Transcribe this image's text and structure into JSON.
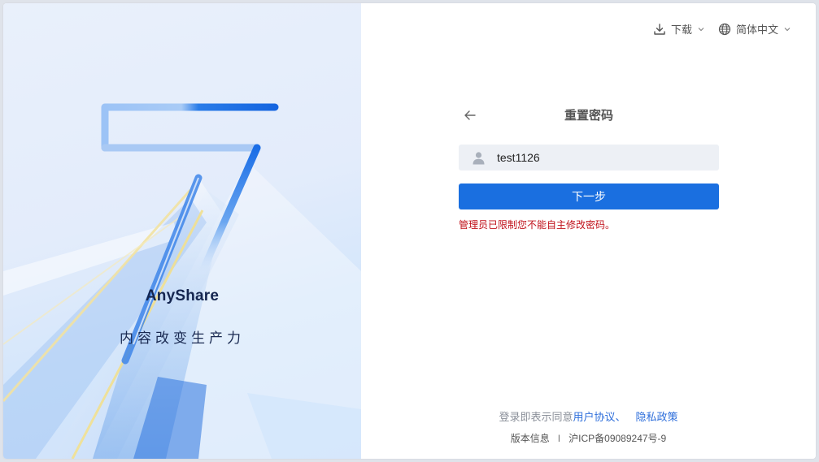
{
  "brand": {
    "name": "AnyShare",
    "slogan": "内容改变生产力"
  },
  "top_bar": {
    "download_label": "下载",
    "language_label": "简体中文"
  },
  "form": {
    "title": "重置密码",
    "account_value": "test1126",
    "next_button_label": "下一步",
    "error_message": "管理员已限制您不能自主修改密码。"
  },
  "footer": {
    "agree_prefix": "登录即表示同意",
    "user_agreement": "用户协议",
    "separator": "、",
    "privacy_policy": "隐私政策",
    "version_info": "版本信息",
    "divider": "I",
    "icp": "沪ICP备09089247号-9"
  },
  "colors": {
    "primary": "#1a6fe0",
    "error": "#c0101a",
    "link": "#2f6fdb",
    "input_bg": "#edf0f5"
  }
}
